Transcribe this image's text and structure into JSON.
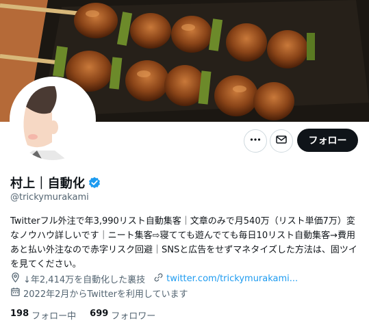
{
  "profile": {
    "display_name": "村上｜自動化",
    "handle": "@trickymurakami",
    "bio": "Twitterフル外注で年3,990リスト自動集客｜文章のみで月540万（リスト単価7万）変なノウハウ詳しいです｜ニート集客⇨寝てても遊んでても毎日10リスト自動集客→費用あと払い外注なので赤字リスク回避｜SNSと広告をせずマネタイズした方法は、固ツイを見てください。",
    "location": "↓年2,414万を自動化した裏技",
    "website": "twitter.com/trickymurakami...",
    "joined": "2022年2月からTwitterを利用しています"
  },
  "actions": {
    "follow_label": "フォロー",
    "more_icon": "more-icon",
    "message_icon": "message-icon"
  },
  "stats": {
    "following_count": "198",
    "following_label": "フォロー中",
    "followers_count": "699",
    "followers_label": "フォロワー"
  },
  "colors": {
    "accent": "#1d9bf0",
    "text": "#0f1419",
    "secondary_text": "#536471",
    "follow_button": "#0f1419"
  }
}
